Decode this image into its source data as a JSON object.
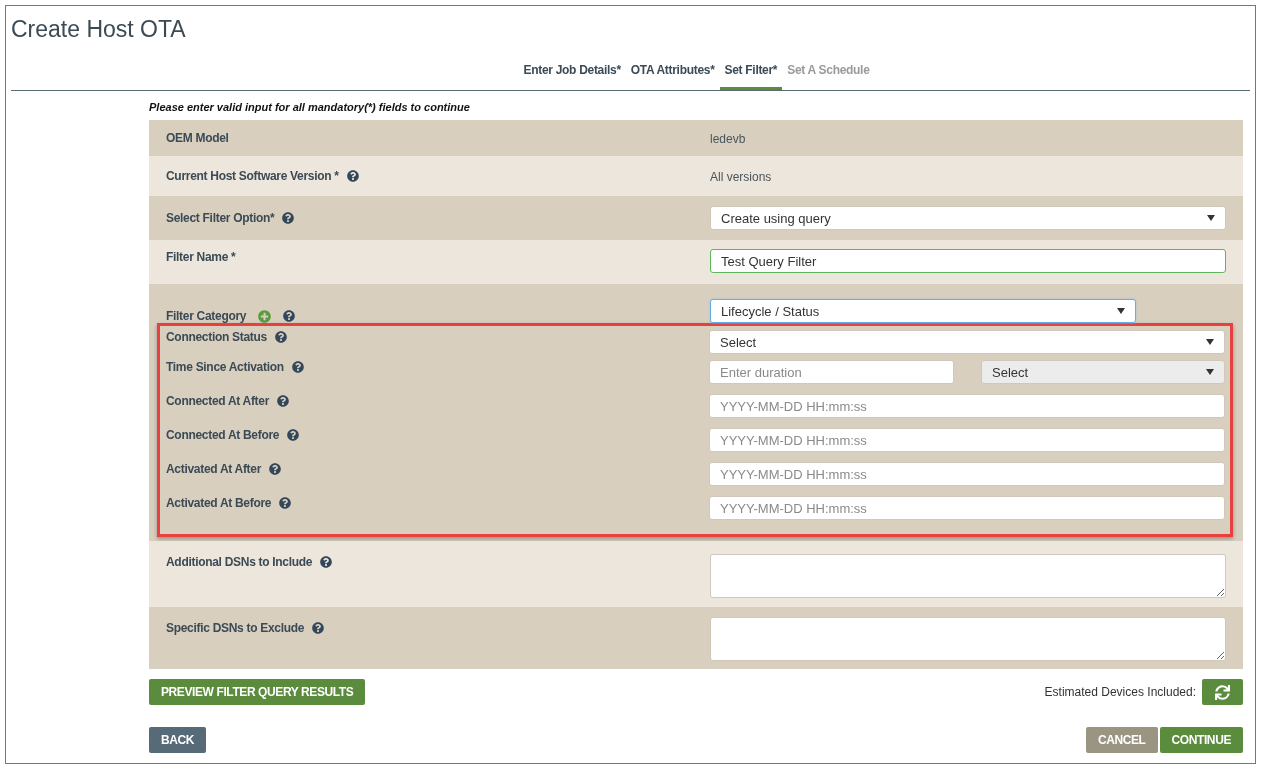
{
  "title": "Create Host OTA",
  "tabs": [
    {
      "label": "Enter Job Details*",
      "selected": false,
      "disabled": false
    },
    {
      "label": "OTA Attributes*",
      "selected": false,
      "disabled": false
    },
    {
      "label": "Set Filter*",
      "selected": true,
      "disabled": false
    },
    {
      "label": "Set A Schedule",
      "selected": false,
      "disabled": true
    }
  ],
  "notice": "Please enter valid input for all mandatory(*) fields to continue",
  "rows": [
    {
      "kind": "text",
      "label": "OEM Model",
      "help": false,
      "value": "ledevb"
    },
    {
      "kind": "text",
      "label": "Current Host Software Version *",
      "help": true,
      "value": "All versions"
    },
    {
      "kind": "select",
      "label": "Select Filter Option*",
      "help": true,
      "value": "Create using query"
    },
    {
      "kind": "input",
      "label": "Filter Name *",
      "help": false,
      "value": "Test Query Filter",
      "valid": true
    }
  ],
  "filter_category": {
    "label": "Filter Category",
    "value": "Lifecycle / Status",
    "focused": true
  },
  "query_group": {
    "highlighted": true,
    "fields": [
      {
        "kind": "select",
        "label": "Connection Status",
        "value": "Select"
      },
      {
        "kind": "duration",
        "label": "Time Since Activation",
        "placeholder": "Enter duration",
        "unit": "Select"
      },
      {
        "kind": "input",
        "label": "Connected At After",
        "placeholder": "YYYY-MM-DD HH:mm:ss"
      },
      {
        "kind": "input",
        "label": "Connected At Before",
        "placeholder": "YYYY-MM-DD HH:mm:ss"
      },
      {
        "kind": "input",
        "label": "Activated At After",
        "placeholder": "YYYY-MM-DD HH:mm:ss"
      },
      {
        "kind": "input",
        "label": "Activated At Before",
        "placeholder": "YYYY-MM-DD HH:mm:ss"
      }
    ]
  },
  "dsn_rows": [
    {
      "label": "Additional DSNs to Include"
    },
    {
      "label": "Specific DSNs to Exclude"
    }
  ],
  "preview_button": "PREVIEW FILTER QUERY RESULTS",
  "estimate_label": "Estimated Devices Included:",
  "back_button": "BACK",
  "cancel_button": "CANCEL",
  "continue_button": "CONTINUE"
}
